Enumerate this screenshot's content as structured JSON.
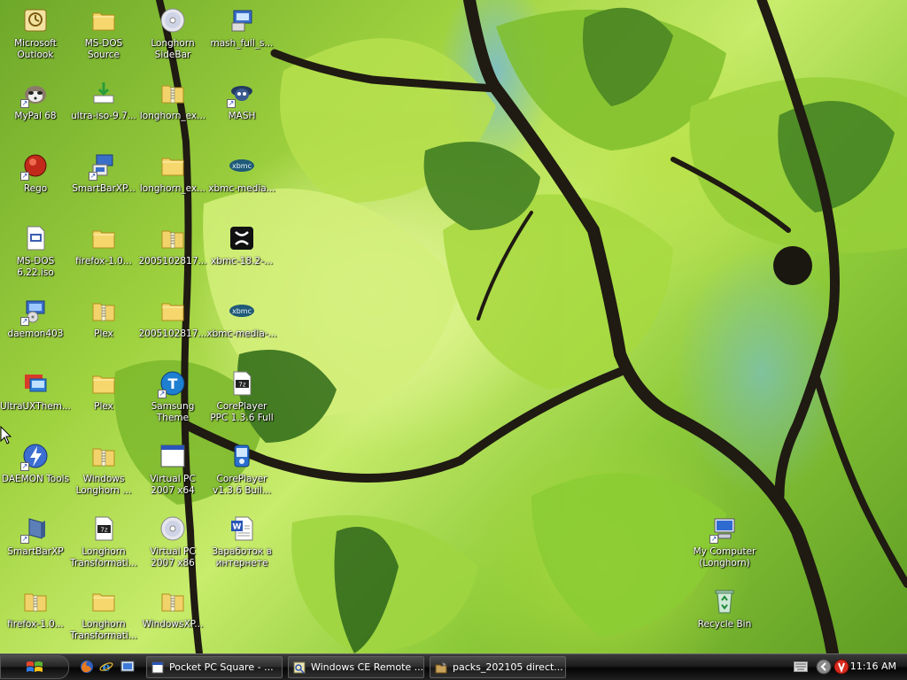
{
  "desktop": {
    "icons": [
      {
        "label": "Microsoft Outlook",
        "icon": "outlook-icon"
      },
      {
        "label": "MS-DOS Source",
        "icon": "folder-icon"
      },
      {
        "label": "Longhorn SideBar",
        "icon": "cd-icon"
      },
      {
        "label": "mash_full_s...",
        "icon": "program-icon"
      },
      {
        "label": "MyPal 68",
        "icon": "mypal-icon"
      },
      {
        "label": "ultra-iso-9.7...",
        "icon": "installer-icon"
      },
      {
        "label": "longhorn_ex...",
        "icon": "zip-folder-icon"
      },
      {
        "label": "MASH",
        "icon": "mash-icon"
      },
      {
        "label": "Rego",
        "icon": "rego-icon"
      },
      {
        "label": "SmartBarXP...",
        "icon": "setup-icon"
      },
      {
        "label": "longhorn_ex...",
        "icon": "folder-icon"
      },
      {
        "label": "xbmc-media...",
        "icon": "xbmc-icon"
      },
      {
        "label": "MS-DOS 6.22.iso",
        "icon": "iso-icon"
      },
      {
        "label": "firefox-1.0...",
        "icon": "folder-icon"
      },
      {
        "label": "2005102817...",
        "icon": "zip-folder-icon"
      },
      {
        "label": "xbmc-18.2-...",
        "icon": "xbmc-x-icon"
      },
      {
        "label": "daemon403",
        "icon": "daemon-setup-icon"
      },
      {
        "label": "Plex",
        "icon": "zip-folder-icon"
      },
      {
        "label": "2005102817...",
        "icon": "folder-icon"
      },
      {
        "label": "xbmc-media-...",
        "icon": "xbmc-icon"
      },
      {
        "label": "UltraUXThem...",
        "icon": "ultraux-icon"
      },
      {
        "label": "Plex",
        "icon": "folder-icon"
      },
      {
        "label": "Samsung Theme",
        "icon": "samsung-theme-icon"
      },
      {
        "label": "CorePlayer PPC 1.3.6 Full",
        "icon": "7z-icon"
      },
      {
        "label": "DAEMON Tools",
        "icon": "daemon-tools-icon"
      },
      {
        "label": "Windows Longhorn ...",
        "icon": "zip-folder-icon"
      },
      {
        "label": "Virtual PC 2007 x64",
        "icon": "window-app-icon"
      },
      {
        "label": "CorePlayer v1.3.6 Buil...",
        "icon": "coreplayer-icon"
      },
      {
        "label": "SmartBarXP",
        "icon": "smartbar-icon"
      },
      {
        "label": "Longhorn Transformati...",
        "icon": "7z-icon"
      },
      {
        "label": "Virtual PC 2007 x86",
        "icon": "cd-icon"
      },
      {
        "label": "Заработок в интернете",
        "icon": "word-doc-icon"
      },
      {
        "label": "My Computer (Longhorn)",
        "icon": "my-computer-icon"
      },
      {
        "label": "firefox-1.0...",
        "icon": "zip-folder-icon"
      },
      {
        "label": "Longhorn Transformati...",
        "icon": "folder-icon"
      },
      {
        "label": "WindowsXP...",
        "icon": "zip-folder-icon"
      },
      {
        "label": "Recycle Bin",
        "icon": "recycle-bin-icon"
      }
    ]
  },
  "taskbar": {
    "start_icon": "windows-logo-icon",
    "quick_launch": [
      "firefox-icon",
      "ie-icon",
      "show-desktop-icon"
    ],
    "tasks": [
      {
        "label": "Pocket PC Square - ...",
        "icon": "program-icon"
      },
      {
        "label": "Windows CE Remote ...",
        "icon": "remote-icon"
      },
      {
        "label": "packs_202105 direct...",
        "icon": "packs-icon"
      }
    ],
    "tray_icons": [
      "keyboard-icon",
      "chevron-left-icon",
      "antivirus-icon"
    ],
    "clock": "11:16 AM"
  }
}
